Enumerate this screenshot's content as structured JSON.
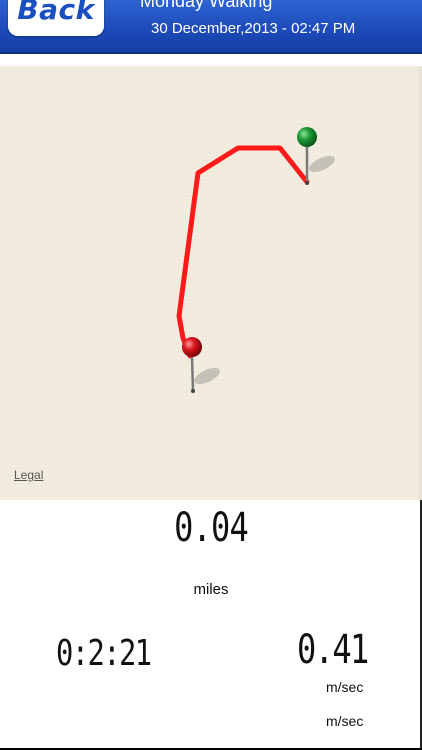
{
  "header": {
    "back_label": "Back",
    "title": "Monday   Walking",
    "subtitle": "30 December,2013 - 02:47 PM"
  },
  "map": {
    "legal_label": "Legal",
    "route_color": "#ff1a1a",
    "start_pin_color": "#1c9a35",
    "end_pin_color": "#d8141c"
  },
  "stats": {
    "distance_value": "0.04",
    "distance_unit": "miles",
    "time_value": "0:2:21",
    "speed_value": "0.41",
    "speed_unit": "m/sec",
    "speed_unit_secondary": "m/sec"
  }
}
